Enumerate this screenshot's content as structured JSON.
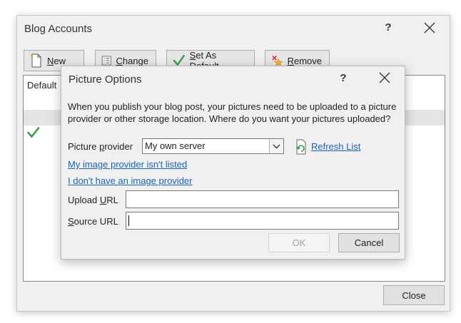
{
  "outer": {
    "title": "Blog Accounts",
    "help_label": "?",
    "toolbar": {
      "new_pre": "",
      "new_acc": "N",
      "new_post": "ew",
      "change_pre": "",
      "change_acc": "C",
      "change_post": "hange",
      "default_pre": "",
      "default_acc": "S",
      "default_post": "et As Default",
      "remove_pre": "",
      "remove_acc": "R",
      "remove_post": "emove"
    },
    "list": {
      "column_default": "Default"
    },
    "close_label": "Close",
    "colors": {
      "check": "#3a9a4c"
    }
  },
  "inner": {
    "title": "Picture Options",
    "help_label": "?",
    "description": "When you publish your blog post, your pictures need to be uploaded to a picture provider or other storage location. Where do you want your pictures uploaded?",
    "provider_label_pre": "Picture ",
    "provider_label_acc": "p",
    "provider_label_post": "rovider",
    "provider_value": "My own server",
    "refresh_label": "Refresh List",
    "link_not_listed": "My image provider isn't listed",
    "link_no_provider": "I don't have an image provider",
    "upload_label_pre": "Upload ",
    "upload_label_acc": "U",
    "upload_label_post": "RL",
    "upload_value": "",
    "source_label_pre": "",
    "source_label_acc": "S",
    "source_label_post": "ource URL",
    "source_value": "",
    "ok_label": "OK",
    "cancel_label": "Cancel"
  }
}
